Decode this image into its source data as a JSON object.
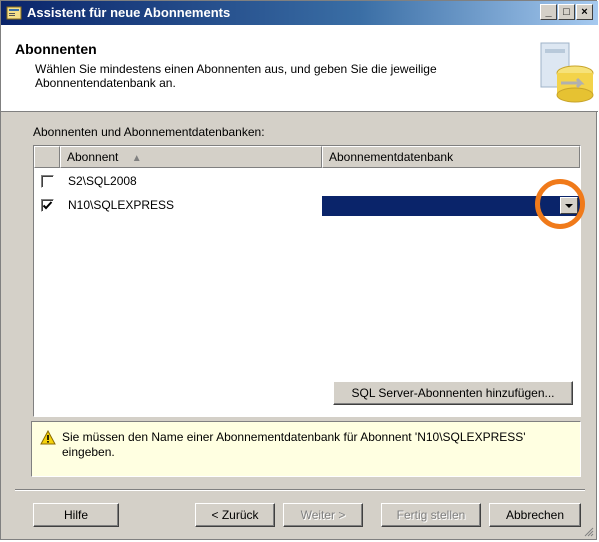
{
  "window": {
    "title": "Assistent für neue Abonnements",
    "controls": [
      "_",
      "□",
      "×"
    ]
  },
  "header": {
    "title": "Abonnenten",
    "description": "Wählen Sie mindestens einen Abonnenten aus, und geben Sie die jeweilige Abonnentendatenbank an.",
    "graphic": "database-wizard-icon"
  },
  "grid": {
    "label": "Abonnenten und Abonnementdatenbanken:",
    "columns": [
      "Abonnent",
      "Abonnementdatenbank"
    ],
    "sort_indicator": "▲",
    "rows": [
      {
        "checked": false,
        "subscriber": "S2\\SQL2008",
        "database": ""
      },
      {
        "checked": true,
        "subscriber": "N10\\SQLEXPRESS",
        "database": ""
      }
    ]
  },
  "add_button": "SQL Server-Abonnenten hinzufügen...",
  "message": {
    "icon": "warning-icon",
    "text": "Sie müssen den Name einer Abonnementdatenbank für Abonnent 'N10\\SQLEXPRESS' eingeben."
  },
  "buttons": {
    "help": "Hilfe",
    "back": "< Zurück",
    "next": "Weiter >",
    "finish": "Fertig stellen",
    "cancel": "Abbrechen"
  },
  "colors": {
    "accent": "#0a246a",
    "highlight_ring": "#f07a1a",
    "message_bg": "#ffffe1"
  }
}
